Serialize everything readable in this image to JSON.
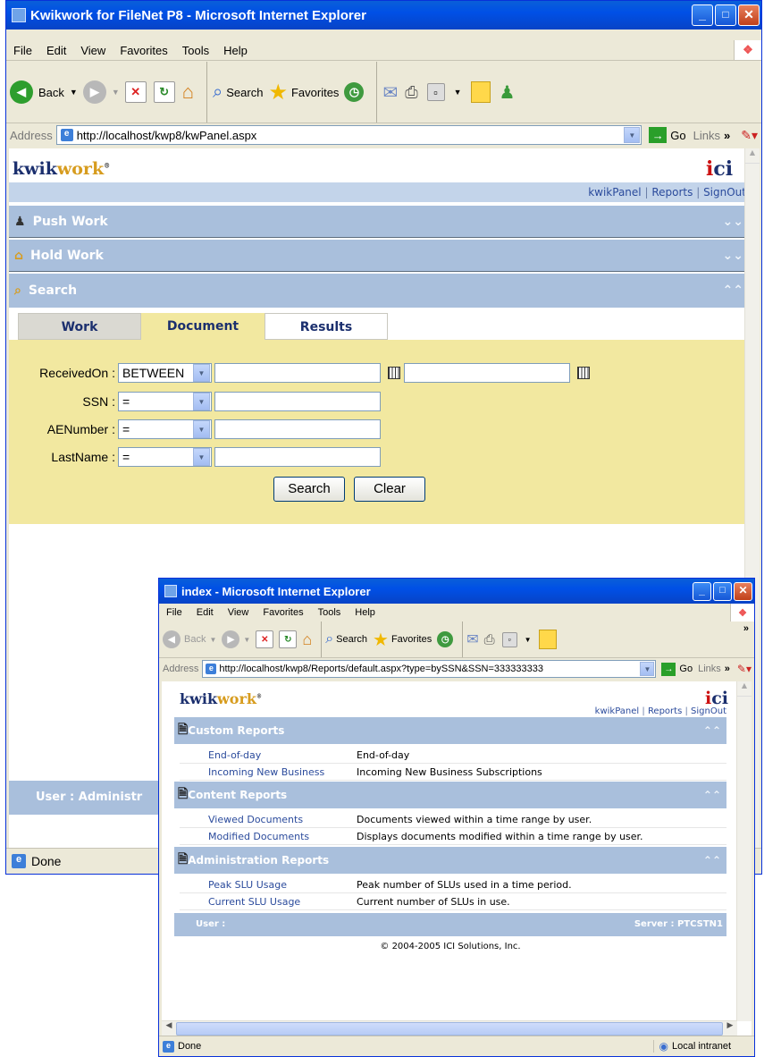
{
  "main_window": {
    "title": "Kwikwork for FileNet P8 - Microsoft Internet Explorer",
    "menu": [
      "File",
      "Edit",
      "View",
      "Favorites",
      "Tools",
      "Help"
    ],
    "toolbar": {
      "back": "Back",
      "search": "Search",
      "favorites": "Favorites"
    },
    "address_label": "Address",
    "url": "http://localhost/kwp8/kwPanel.aspx",
    "go": "Go",
    "links": "Links",
    "status": "Done",
    "page": {
      "brand_kwik": "kwik",
      "brand_work": "work",
      "brand_mark": "®",
      "logo_i": "i",
      "logo_ci": "ci",
      "nav": {
        "kwikpanel": "kwikPanel",
        "reports": "Reports",
        "signout": "SignOut",
        "sep": "|"
      },
      "sections": {
        "push_work": "Push Work",
        "hold_work": "Hold Work",
        "search": "Search"
      },
      "tabs": [
        "Work",
        "Document",
        "Results"
      ],
      "fields": [
        {
          "label": "ReceivedOn :",
          "operator": "BETWEEN"
        },
        {
          "label": "SSN :",
          "operator": "="
        },
        {
          "label": "AENumber :",
          "operator": "="
        },
        {
          "label": "LastName :",
          "operator": "="
        }
      ],
      "search_button": "Search",
      "clear_button": "Clear",
      "footer_user": "User : Administr"
    }
  },
  "popup_window": {
    "title": "index - Microsoft Internet Explorer",
    "menu": [
      "File",
      "Edit",
      "View",
      "Favorites",
      "Tools",
      "Help"
    ],
    "toolbar": {
      "back": "Back",
      "search": "Search",
      "favorites": "Favorites"
    },
    "address_label": "Address",
    "url": "http://localhost/kwp8/Reports/default.aspx?type=bySSN&SSN=333333333",
    "go": "Go",
    "links": "Links",
    "status": "Done",
    "zone": "Local intranet",
    "page": {
      "brand_kwik": "kwik",
      "brand_work": "work",
      "brand_mark": "®",
      "logo_i": "i",
      "logo_ci": "ci",
      "nav": {
        "kwikpanel": "kwikPanel",
        "reports": "Reports",
        "signout": "SignOut",
        "sep": "|"
      },
      "groups": [
        {
          "title": "Custom Reports",
          "rows": [
            {
              "name": "End-of-day",
              "desc": "End-of-day"
            },
            {
              "name": "Incoming New Business",
              "desc": "Incoming New Business Subscriptions"
            }
          ]
        },
        {
          "title": "Content Reports",
          "rows": [
            {
              "name": "Viewed Documents",
              "desc": "Documents viewed within a time range by user."
            },
            {
              "name": "Modified Documents",
              "desc": "Displays documents modified within a time range by user."
            }
          ]
        },
        {
          "title": "Administration Reports",
          "rows": [
            {
              "name": "Peak SLU Usage",
              "desc": "Peak number of SLUs used in a time period."
            },
            {
              "name": "Current SLU Usage",
              "desc": "Current number of SLUs in use."
            }
          ]
        }
      ],
      "footer_user": "User :",
      "footer_server": "Server : PTCSTN1",
      "copyright": "© 2004-2005 ICI Solutions, Inc."
    }
  }
}
